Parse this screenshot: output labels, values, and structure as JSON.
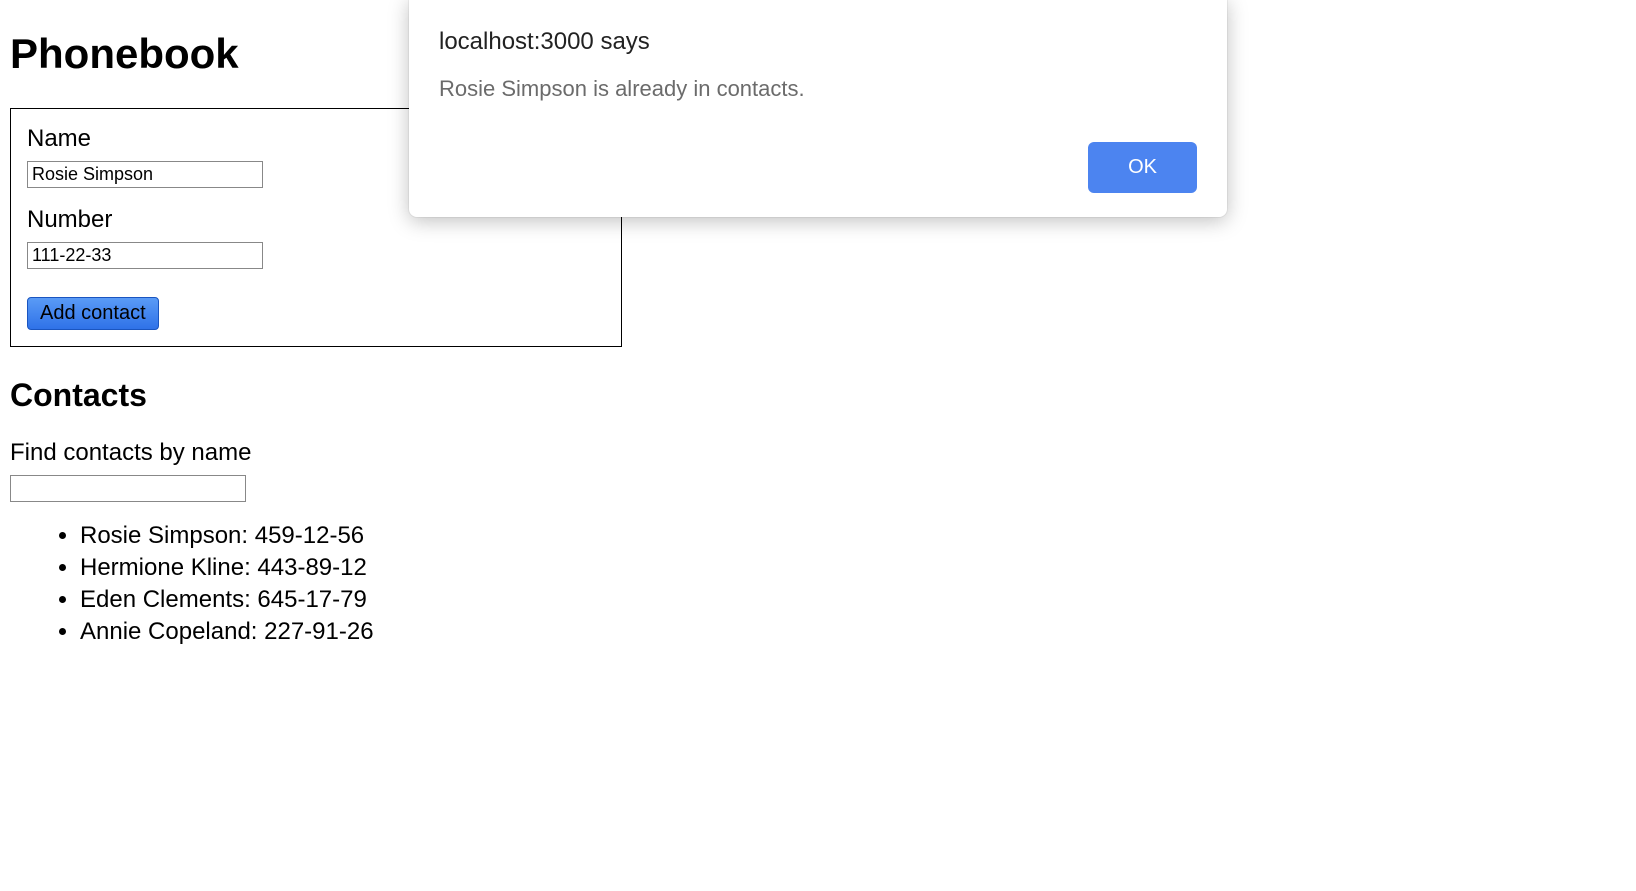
{
  "page": {
    "title": "Phonebook",
    "contacts_heading": "Contacts"
  },
  "form": {
    "name_label": "Name",
    "name_value": "Rosie Simpson",
    "number_label": "Number",
    "number_value": "111-22-33",
    "submit_label": "Add contact"
  },
  "filter": {
    "label": "Find contacts by name",
    "value": ""
  },
  "contacts": [
    {
      "name": "Rosie Simpson",
      "number": "459-12-56"
    },
    {
      "name": "Hermione Kline",
      "number": "443-89-12"
    },
    {
      "name": "Eden Clements",
      "number": "645-17-79"
    },
    {
      "name": "Annie Copeland",
      "number": "227-91-26"
    }
  ],
  "alert": {
    "title": "localhost:3000 says",
    "message": "Rosie Simpson is already in contacts.",
    "ok_label": "OK"
  }
}
